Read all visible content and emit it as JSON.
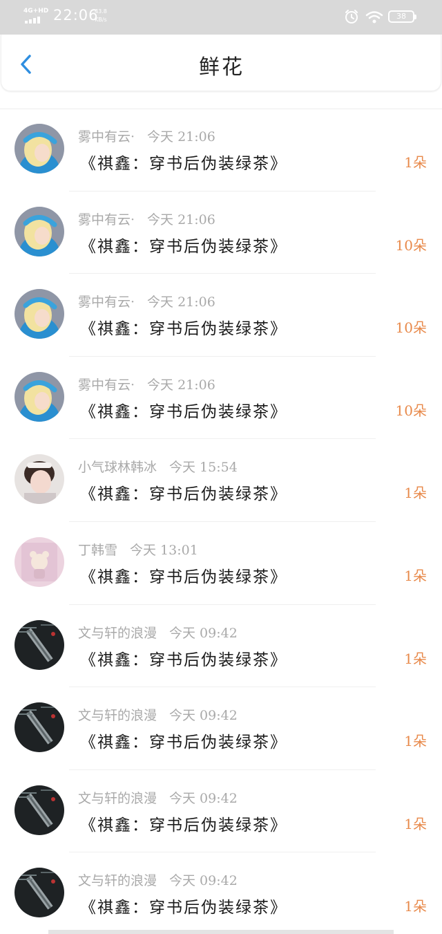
{
  "status_bar": {
    "network": "4G+HD",
    "time": "22:06",
    "speed_value": "43.8",
    "speed_unit": "KB/s",
    "battery": "38"
  },
  "nav": {
    "back_icon": "chevron-left-icon",
    "title": "鲜花"
  },
  "colors": {
    "accent": "#2f8ee0",
    "count": "#e8894a",
    "meta": "#a9a9a9",
    "status_bar_bg": "#d9d9d9"
  },
  "rows": [
    {
      "user": "雾中有云·",
      "time": "今天 21:06",
      "book": "《祺鑫：穿书后伪装绿茶》",
      "count": "1朵",
      "avatar": "blonde-girl-avatar"
    },
    {
      "user": "雾中有云·",
      "time": "今天 21:06",
      "book": "《祺鑫：穿书后伪装绿茶》",
      "count": "10朵",
      "avatar": "blonde-girl-avatar"
    },
    {
      "user": "雾中有云·",
      "time": "今天 21:06",
      "book": "《祺鑫：穿书后伪装绿茶》",
      "count": "10朵",
      "avatar": "blonde-girl-avatar"
    },
    {
      "user": "雾中有云·",
      "time": "今天 21:06",
      "book": "《祺鑫：穿书后伪装绿茶》",
      "count": "10朵",
      "avatar": "blonde-girl-avatar"
    },
    {
      "user": "小气球林韩冰",
      "time": "今天 15:54",
      "book": "《祺鑫：穿书后伪装绿茶》",
      "count": "1朵",
      "avatar": "girl-photo-avatar"
    },
    {
      "user": "丁韩雪",
      "time": "今天 13:01",
      "book": "《祺鑫：穿书后伪装绿茶》",
      "count": "1朵",
      "avatar": "pink-bear-avatar"
    },
    {
      "user": "文与轩的浪漫",
      "time": "今天 09:42",
      "book": "《祺鑫：穿书后伪装绿茶》",
      "count": "1朵",
      "avatar": "dark-photo-avatar"
    },
    {
      "user": "文与轩的浪漫",
      "time": "今天 09:42",
      "book": "《祺鑫：穿书后伪装绿茶》",
      "count": "1朵",
      "avatar": "dark-photo-avatar"
    },
    {
      "user": "文与轩的浪漫",
      "time": "今天 09:42",
      "book": "《祺鑫：穿书后伪装绿茶》",
      "count": "1朵",
      "avatar": "dark-photo-avatar"
    },
    {
      "user": "文与轩的浪漫",
      "time": "今天 09:42",
      "book": "《祺鑫：穿书后伪装绿茶》",
      "count": "1朵",
      "avatar": "dark-photo-avatar"
    }
  ]
}
